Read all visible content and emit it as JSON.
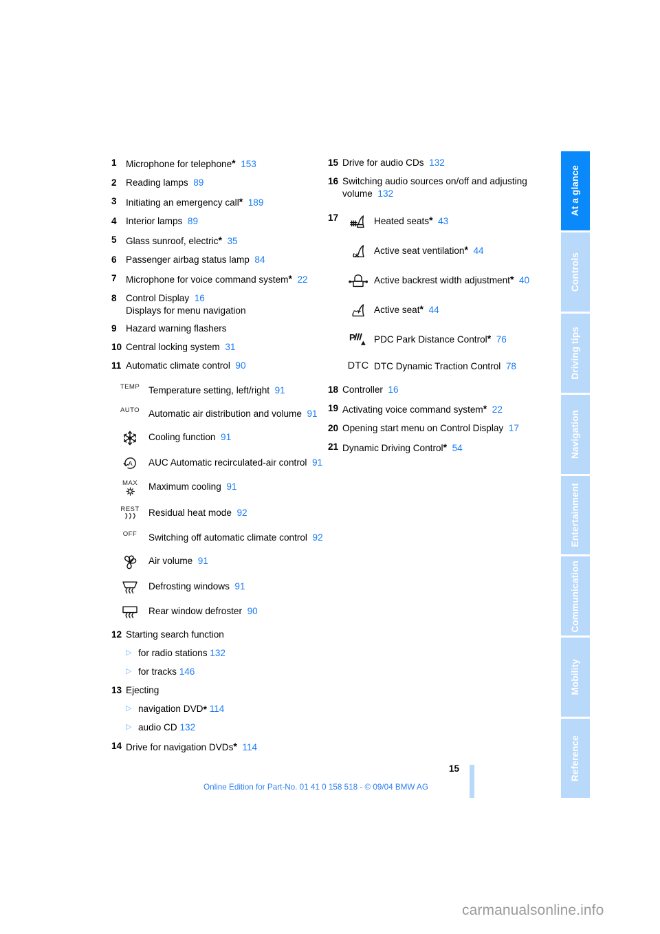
{
  "document": {
    "page_number": "15",
    "footer_note": "Online Edition for Part-No. 01 41 0 158 518 - © 09/04 BMW AG",
    "watermark": "carmanualsonline.info",
    "link_color": "#1a7cf5",
    "tab_active_color": "#0a8afa",
    "tab_inactive_color": "#b9d9fb"
  },
  "tabs": [
    {
      "label": "At a glance",
      "active": true
    },
    {
      "label": "Controls",
      "active": false
    },
    {
      "label": "Driving tips",
      "active": false
    },
    {
      "label": "Navigation",
      "active": false
    },
    {
      "label": "Entertainment",
      "active": false
    },
    {
      "label": "Communication",
      "active": false
    },
    {
      "label": "Mobility",
      "active": false
    },
    {
      "label": "Reference",
      "active": false
    }
  ],
  "left_column": {
    "items": [
      {
        "num": "1",
        "text": "Microphone for telephone",
        "star": true,
        "page": "153"
      },
      {
        "num": "2",
        "text": "Reading lamps",
        "star": false,
        "page": "89"
      },
      {
        "num": "3",
        "text": "Initiating an emergency call",
        "star": true,
        "page": "189"
      },
      {
        "num": "4",
        "text": "Interior lamps",
        "star": false,
        "page": "89"
      },
      {
        "num": "5",
        "text": "Glass sunroof, electric",
        "star": true,
        "page": "35"
      },
      {
        "num": "6",
        "text": "Passenger airbag status lamp",
        "star": false,
        "page": "84"
      },
      {
        "num": "7",
        "text": "Microphone for voice command system",
        "star": true,
        "page": "22"
      },
      {
        "num": "8",
        "text": "Control Display",
        "star": false,
        "page": "16",
        "subtitle": "Displays for menu navigation"
      },
      {
        "num": "9",
        "text": "Hazard warning flashers",
        "star": false,
        "page": ""
      },
      {
        "num": "10",
        "text": "Central locking system",
        "star": false,
        "page": "31"
      },
      {
        "num": "11",
        "text": "Automatic climate control",
        "star": false,
        "page": "90"
      }
    ],
    "climate_icons": [
      {
        "icon": "temp-icon",
        "glyph_text": "TEMP",
        "label": "Temperature setting, left/right",
        "page": "91"
      },
      {
        "icon": "auto-icon",
        "glyph_text": "AUTO",
        "label": "Automatic air distribution and volume",
        "page": "91"
      },
      {
        "icon": "snowflake-icon",
        "glyph_text": "",
        "label": "Cooling function",
        "page": "91"
      },
      {
        "icon": "auc-recirculation-icon",
        "glyph_text": "",
        "label": "AUC Automatic recirculated-air control",
        "page": "91"
      },
      {
        "icon": "max-cooling-icon",
        "glyph_text": "MAX",
        "label": "Maximum cooling",
        "page": "91"
      },
      {
        "icon": "residual-heat-icon",
        "glyph_text": "REST",
        "label": "Residual heat mode",
        "page": "92"
      },
      {
        "icon": "off-icon",
        "glyph_text": "OFF",
        "label": "Switching off automatic climate control",
        "page": "92"
      },
      {
        "icon": "fan-icon",
        "glyph_text": "",
        "label": "Air volume",
        "page": "91"
      },
      {
        "icon": "windshield-defrost-icon",
        "glyph_text": "",
        "label": "Defrosting windows",
        "page": "91"
      },
      {
        "icon": "rear-defrost-icon",
        "glyph_text": "",
        "label": "Rear window defroster",
        "page": "90"
      }
    ],
    "items_bottom": [
      {
        "num": "12",
        "text": "Starting search function",
        "star": false,
        "page": "",
        "bullets": [
          {
            "text": "for radio stations",
            "star": false,
            "page": "132"
          },
          {
            "text": "for tracks",
            "star": false,
            "page": "146"
          }
        ]
      },
      {
        "num": "13",
        "text": "Ejecting",
        "star": false,
        "page": "",
        "bullets": [
          {
            "text": "navigation DVD",
            "star": true,
            "page": "114"
          },
          {
            "text": "audio CD",
            "star": false,
            "page": "132"
          }
        ]
      },
      {
        "num": "14",
        "text": "Drive for navigation DVDs",
        "star": true,
        "page": "114",
        "bullets": []
      }
    ]
  },
  "right_column": {
    "items_top": [
      {
        "num": "15",
        "text": "Drive for audio CDs",
        "star": false,
        "page": "132"
      },
      {
        "num": "16",
        "text": "Switching audio sources on/off and adjusting volume",
        "star": false,
        "page": "132"
      }
    ],
    "group_17": {
      "num": "17",
      "icons": [
        {
          "icon": "heated-seat-icon",
          "label": "Heated seats",
          "star": true,
          "page": "43"
        },
        {
          "icon": "seat-ventilation-icon",
          "label": "Active seat ventilation",
          "star": true,
          "page": "44"
        },
        {
          "icon": "backrest-width-icon",
          "label": "Active backrest width adjustment",
          "star": true,
          "page": "40"
        },
        {
          "icon": "active-seat-icon",
          "label": "Active seat",
          "star": true,
          "page": "44"
        },
        {
          "icon": "pdc-icon",
          "label": "PDC Park Distance Control",
          "star": true,
          "page": "76"
        },
        {
          "icon": "dtc-icon",
          "glyph_text": "DTC",
          "label": "DTC Dynamic Traction Control",
          "star": false,
          "page": "78"
        }
      ]
    },
    "items_bottom": [
      {
        "num": "18",
        "text": "Controller",
        "star": false,
        "page": "16"
      },
      {
        "num": "19",
        "text": "Activating voice command system",
        "star": true,
        "page": "22"
      },
      {
        "num": "20",
        "text": "Opening start menu on Control Display",
        "star": false,
        "page": "17"
      },
      {
        "num": "21",
        "text": "Dynamic Driving Control",
        "star": true,
        "page": "54"
      }
    ]
  }
}
